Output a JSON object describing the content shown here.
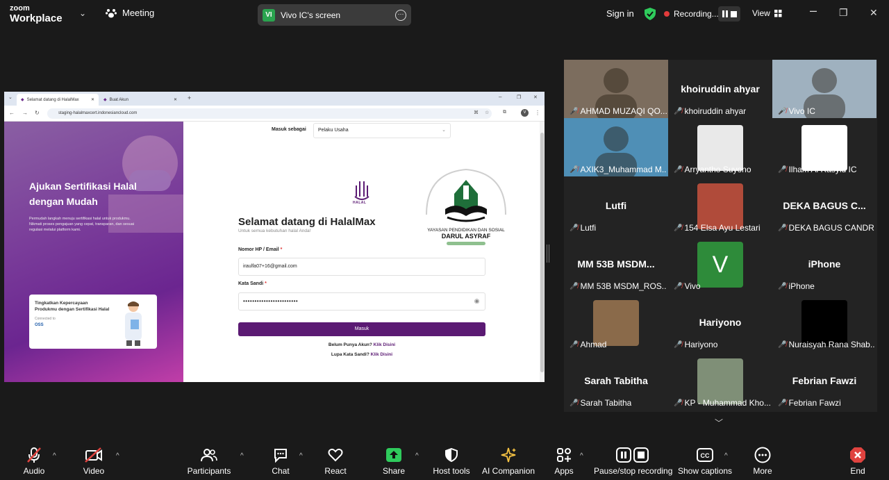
{
  "top": {
    "logo_line1": "zoom",
    "logo_line2": "Workplace",
    "meeting_label": "Meeting",
    "share_avatar": "VI",
    "share_label": "Vivo IC's screen",
    "sign_in": "Sign in",
    "recording": "Recording...",
    "view": "View"
  },
  "browser": {
    "tab1": "Selamat datang di HalalMax",
    "tab2": "Buat Akun",
    "url": "staging-halalmaxcert.indonesiancloud.com",
    "profile": "V"
  },
  "left": {
    "title": "Ajukan Sertifikasi Halal dengan Mudah",
    "desc": "Permudah langkah menuju sertifikasi halal untuk produkmu. Nikmati proses pengajuan yang cepat, transparan, dan sesuai regulasi melalui platform kami.",
    "card_title": "Tingkatkan Kepercayaan Produkmu dengan Sertifikasi Halal",
    "card_connected": "Connected to",
    "card_oss": "OSS"
  },
  "login": {
    "role_label": "Masuk sebagai",
    "role_value": "Pelaku Usaha",
    "halal_logo_text": "HALAL",
    "heading": "Selamat datang di HalalMax",
    "subheading": "Untuk semua kebutuhan halal Anda!",
    "phone_label": "Nomor HP / Email",
    "phone_value": "iraulfa07+16@gmail.com",
    "password_label": "Kata Sandi",
    "password_value": "••••••••••••••••••••••••",
    "required_mark": "*",
    "submit": "Masuk",
    "no_account": "Belum Punya Akun?",
    "click_here": "Klik Disini",
    "forgot": "Lupa Kata Sandi?",
    "click_here2": "Klik Disini"
  },
  "school": {
    "line1": "YAYASAN PENDIDIKAN DAN SOSIAL",
    "line2": "DARUL ASYRAF"
  },
  "participants": [
    {
      "name": "AHMAD MUZAQI QO...",
      "type": "photo",
      "color": "#7c6d5e"
    },
    {
      "name": "khoiruddin ahyar",
      "type": "text",
      "big": "khoiruddin ahyar"
    },
    {
      "name": "Vivo IC",
      "type": "photo",
      "color": "#9fb1bf",
      "highlight": true
    },
    {
      "name": "AXIK3_Muhammad M...",
      "type": "photo",
      "color": "#4f8fb6"
    },
    {
      "name": "Arryantho Suyono",
      "type": "thumb",
      "color": "#e9e9e9"
    },
    {
      "name": "Ilham Al Rasyid IC",
      "type": "thumb",
      "color": "#ffffff"
    },
    {
      "name": "Lutfi",
      "type": "text",
      "big": "Lutfi"
    },
    {
      "name": "154 Elsa Ayu Lestari",
      "type": "thumb",
      "color": "#b04b3a"
    },
    {
      "name": "DEKA BAGUS CANDR...",
      "type": "text",
      "big": "DEKA BAGUS C..."
    },
    {
      "name": "MM 53B MSDM_ROS...",
      "type": "text",
      "big": "MM 53B  MSDM..."
    },
    {
      "name": "Vivo",
      "type": "letter",
      "letter": "V",
      "color": "#2e8b3a"
    },
    {
      "name": "iPhone",
      "type": "text",
      "big": "iPhone"
    },
    {
      "name": "Ahmad",
      "type": "thumb",
      "color": "#8a6a4a"
    },
    {
      "name": "Hariyono",
      "type": "text",
      "big": "Hariyono"
    },
    {
      "name": "Nuraisyah Rana Shab...",
      "type": "thumb",
      "color": "#000000"
    },
    {
      "name": "Sarah Tabitha",
      "type": "text",
      "big": "Sarah Tabitha"
    },
    {
      "name": "KP - Muhammad Kho...",
      "type": "thumb",
      "color": "#7f8f77"
    },
    {
      "name": "Febrian Fawzi",
      "type": "text",
      "big": "Febrian Fawzi"
    }
  ],
  "toolbar": {
    "audio": "Audio",
    "video": "Video",
    "participants": "Participants",
    "participants_count": "",
    "chat": "Chat",
    "react": "React",
    "share": "Share",
    "host_tools": "Host tools",
    "ai_companion": "AI Companion",
    "apps": "Apps",
    "pause_rec": "Pause/stop recording",
    "captions": "Show captions",
    "more": "More",
    "end": "End"
  },
  "colors": {
    "accent_green": "#2fcb5c",
    "record_red": "#e23b3b",
    "halal_purple": "#5b1a73",
    "muted_red": "#e0433f"
  }
}
